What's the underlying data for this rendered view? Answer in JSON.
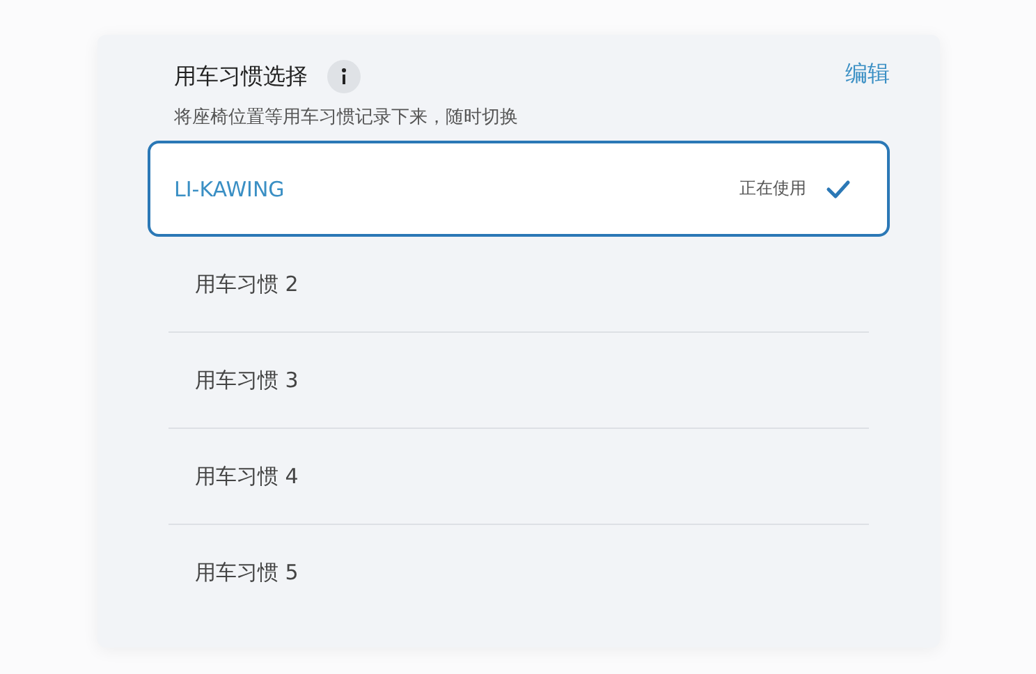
{
  "header": {
    "title": "用车习惯选择",
    "subtitle": "将座椅位置等用车习惯记录下来，随时切换",
    "edit": "编辑"
  },
  "habits": [
    {
      "label": "LI-KAWING",
      "selected": true,
      "status": "正在使用"
    },
    {
      "label": "用车习惯 2",
      "selected": false
    },
    {
      "label": "用车习惯 3",
      "selected": false
    },
    {
      "label": "用车习惯 4",
      "selected": false
    },
    {
      "label": "用车习惯 5",
      "selected": false
    }
  ]
}
